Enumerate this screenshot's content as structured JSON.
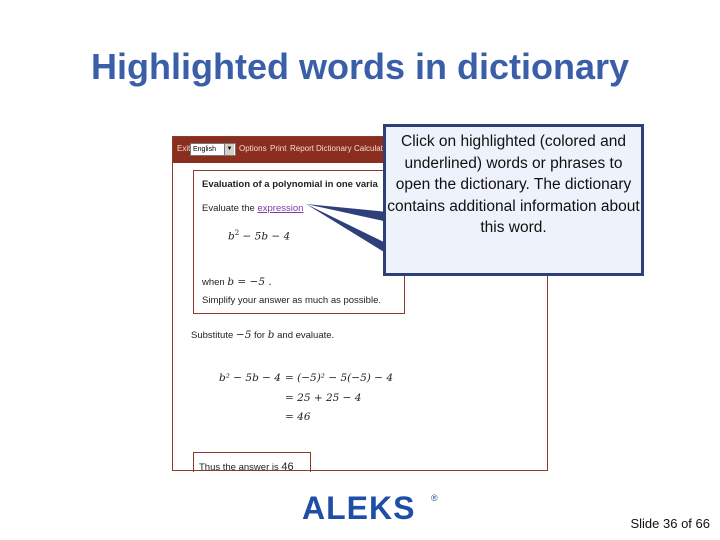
{
  "slide": {
    "title": "Highlighted words in dictionary",
    "slide_number": "Slide 36 of 66"
  },
  "toolbar": {
    "exit": "Exit",
    "language": "English",
    "options": "Options",
    "print": "Print",
    "report": "Report",
    "dictionary": "Dictionary",
    "calculator": "Calculat"
  },
  "problem": {
    "heading": "Evaluation of a polynomial in one varia",
    "evaluate_prefix": "Evaluate the ",
    "evaluate_link": "expression",
    "expr_var1": "b",
    "expr_exp": "2",
    "expr_rest": " − 5b − 4",
    "when_label": "when ",
    "when_value": "b = −5 .",
    "simplify": "Simplify your answer as much as possible."
  },
  "solution": {
    "substitute_label": "Substitute ",
    "substitute_value": "−5",
    "substitute_rest": " for ",
    "substitute_var": "b",
    "substitute_end": " and evaluate.",
    "line1_lhs": "b² − 5b − 4",
    "line1_rhs": "= (−5)² − 5(−5) − 4",
    "line2": "= 25 + 25 − 4",
    "line3": "= 46",
    "answer_label": "Thus the answer is ",
    "answer_value": "46"
  },
  "callout": {
    "text": "Click on highlighted (colored and underlined) words or phrases to open the dictionary. The dictionary contains additional information about this word."
  },
  "logo": {
    "text": "ALEKS",
    "registered": "®"
  },
  "colors": {
    "title": "#3a5fa8",
    "toolbar_bg": "#8b2e1f",
    "callout_border": "#2f3f7a",
    "callout_bg": "#eef2fa",
    "link": "#7a3fa6",
    "logo": "#1e4ea6"
  }
}
